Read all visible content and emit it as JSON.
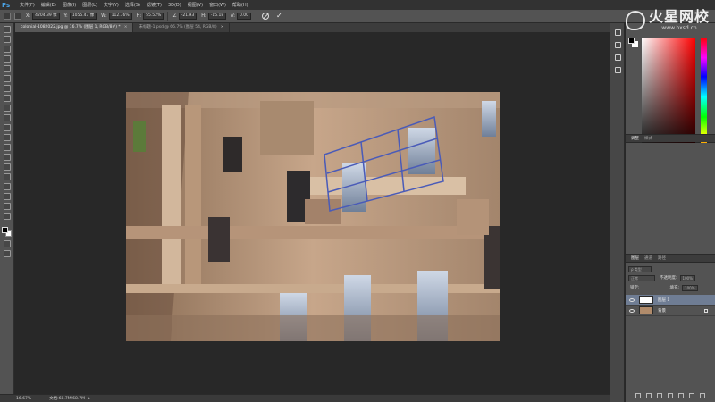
{
  "app": {
    "logo": "Ps"
  },
  "menu": [
    "文件(F)",
    "编辑(E)",
    "图像(I)",
    "图层(L)",
    "文字(Y)",
    "选择(S)",
    "滤镜(T)",
    "3D(D)",
    "视图(V)",
    "窗口(W)",
    "帮助(H)"
  ],
  "watermark": {
    "title": "火星网校",
    "url": "www.hxsd.cn"
  },
  "options": {
    "x_label": "X:",
    "x": "4204.39 像",
    "y_label": "Y:",
    "y": "1055.47 像",
    "w_label": "W:",
    "w": "112.76%",
    "h_label": "H:",
    "h": "55.52%",
    "angle": "-21.93",
    "hskew": "-15.18",
    "vskew": "0.00"
  },
  "tabs": [
    {
      "label": "colonial-1082022.jpg @ 16.7% (图层 1, RGB/8#) *",
      "active": true
    },
    {
      "label": "未标题-1.psd @ 66.7% (图层 54, RGB/8)",
      "active": false
    }
  ],
  "status": {
    "zoom": "16.67%",
    "doc": "文档:68.7M/68.7M"
  },
  "panels": {
    "color": {
      "tabs": [
        "颜色",
        "色板"
      ]
    },
    "adjust": {
      "tabs": [
        "调整",
        "样式"
      ]
    },
    "layers": {
      "tabs": [
        "图层",
        "通道",
        "路径"
      ],
      "blend": "正常",
      "opacity_label": "不透明度:",
      "opacity": "100%",
      "lock_label": "锁定:",
      "fill_label": "填充:",
      "fill": "100%",
      "items": [
        {
          "name": "图层 1",
          "selected": true,
          "locked": false
        },
        {
          "name": "背景",
          "selected": false,
          "locked": true
        }
      ]
    }
  },
  "colors": {
    "fg": "#000000",
    "bg": "#ffffff",
    "accent": "#6f7d94"
  }
}
